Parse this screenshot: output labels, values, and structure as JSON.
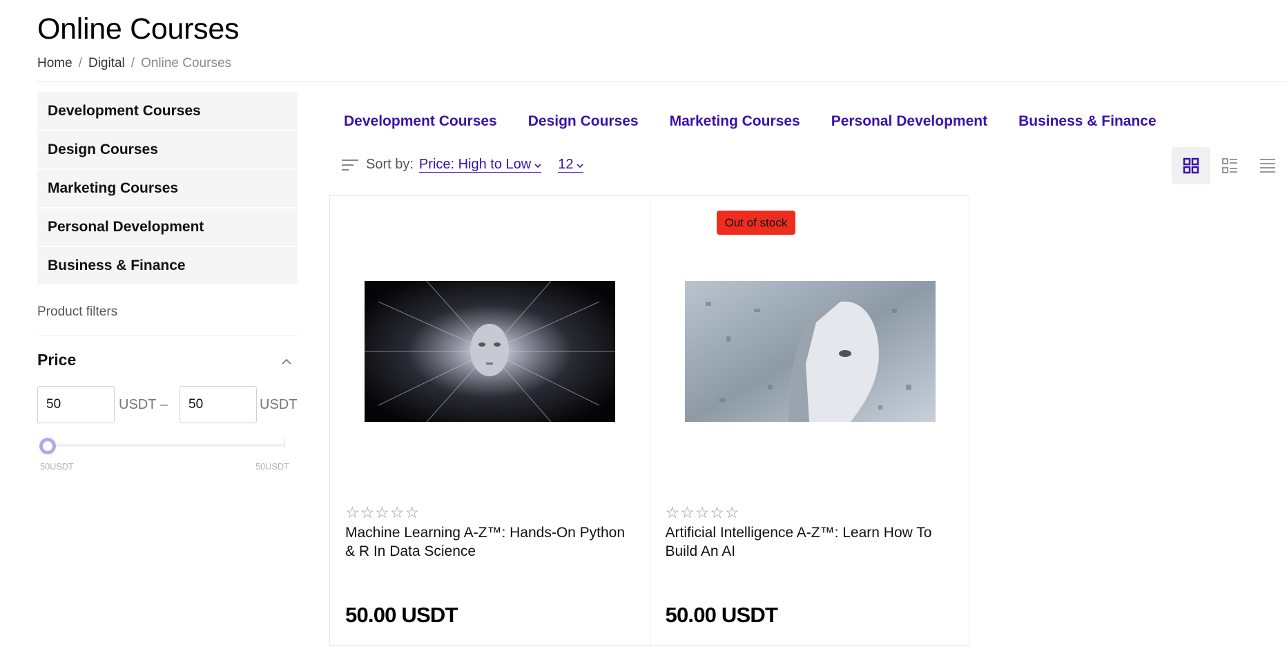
{
  "page": {
    "title": "Online Courses"
  },
  "breadcrumb": {
    "home": "Home",
    "parent": "Digital",
    "current": "Online Courses",
    "separator": "/"
  },
  "sidebar": {
    "categories": [
      {
        "label": "Development Courses"
      },
      {
        "label": "Design Courses"
      },
      {
        "label": "Marketing Courses"
      },
      {
        "label": "Personal Development"
      },
      {
        "label": "Business & Finance"
      }
    ],
    "filters_title": "Product filters",
    "price": {
      "title": "Price",
      "min_value": "50",
      "max_value": "50",
      "unit_min": "USDT –",
      "unit_max": "USDT",
      "slider_min_label": "50USDT",
      "slider_max_label": "50USDT",
      "accent": "#b9a3ef"
    }
  },
  "topnav": [
    {
      "label": "Development Courses"
    },
    {
      "label": "Design Courses"
    },
    {
      "label": "Marketing Courses"
    },
    {
      "label": "Personal Development"
    },
    {
      "label": "Business & Finance"
    }
  ],
  "sort": {
    "label": "Sort by:",
    "value": "Price: High to Low",
    "per_page": "12"
  },
  "view_modes": [
    "grid-view-icon",
    "list-grid-view-icon",
    "list-view-icon"
  ],
  "products": [
    {
      "title": "Machine Learning A-Z™: Hands-On Python & R In Data Science",
      "price": "50.00 USDT",
      "rating_stars": "☆☆☆☆☆",
      "badge": ""
    },
    {
      "title": "Artificial Intelligence A-Z™: Learn How To Build An AI",
      "price": "50.00 USDT",
      "rating_stars": "☆☆☆☆☆",
      "badge": "Out of stock"
    }
  ],
  "colors": {
    "link": "#3a10b0",
    "badge": "#ee2d1f"
  }
}
